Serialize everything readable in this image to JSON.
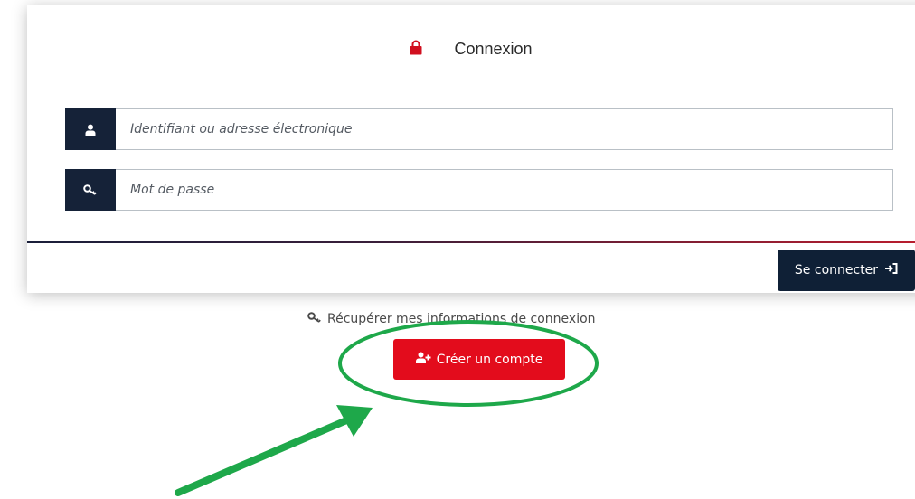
{
  "login": {
    "title": "Connexion",
    "username_placeholder": "Identifiant ou adresse électronique",
    "password_placeholder": "Mot de passe",
    "submit_label": "Se connecter"
  },
  "links": {
    "recover_label": "Récupérer mes informations de connexion",
    "create_account_label": "Créer un compte"
  },
  "icons": {
    "lock": "lock-icon",
    "user": "user-icon",
    "key": "key-icon",
    "sign_in": "sign-in-icon",
    "add_user": "add-user-icon"
  },
  "colors": {
    "navy": "#152238",
    "red": "#e30c1c",
    "annotation_green": "#1ea84a"
  }
}
